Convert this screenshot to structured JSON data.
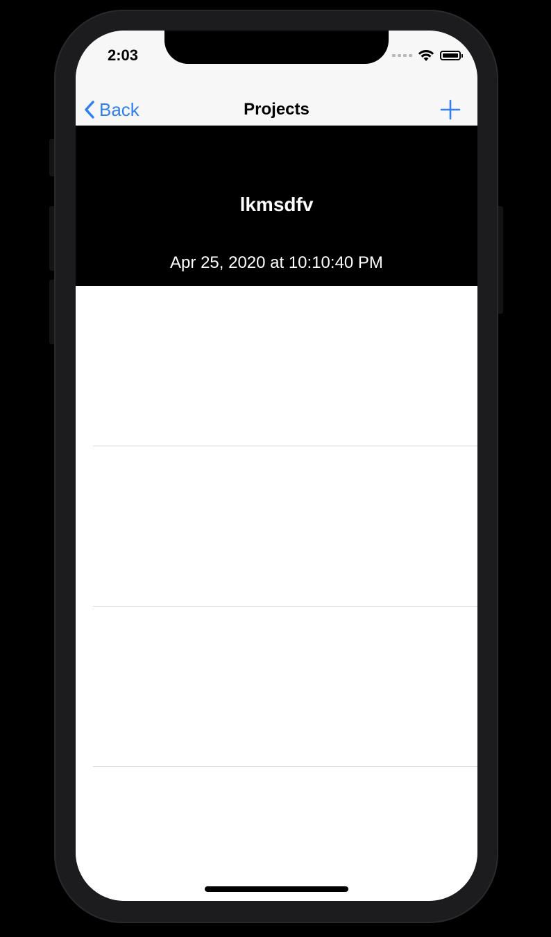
{
  "status_bar": {
    "time": "2:03",
    "icons": [
      "signal-icon",
      "wifi-icon",
      "battery-icon"
    ]
  },
  "nav_bar": {
    "back_label": "Back",
    "title": "Projects",
    "add_icon": "plus-icon"
  },
  "project": {
    "name": "lkmsdfv",
    "date": "Apr 25, 2020 at 10:10:40 PM"
  },
  "list": {
    "rows": [
      "",
      "",
      "",
      ""
    ]
  },
  "colors": {
    "accent": "#2f7ff0",
    "header_bg": "#000000",
    "nav_bg": "#f7f7f7",
    "device_frame": "#1c1c1e"
  }
}
